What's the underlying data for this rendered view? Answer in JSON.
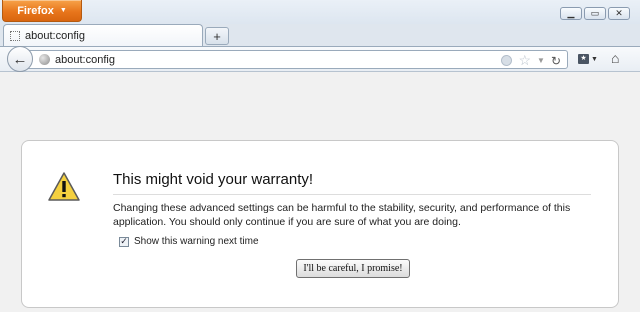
{
  "window": {
    "firefox_button_label": "Firefox",
    "controls": {
      "minimize": "▁",
      "restore": "▭",
      "close": "✕"
    }
  },
  "tabs": [
    {
      "label": "about:config",
      "active": true
    }
  ],
  "new_tab_symbol": "+",
  "navbar": {
    "url": "about:config"
  },
  "warning": {
    "title": "This might void your warranty!",
    "description": "Changing these advanced settings can be harmful to the stability, security, and performance of this application. You should only continue if you are sure of what you are doing.",
    "checkbox_label": "Show this warning next time",
    "checkbox_checked": true,
    "button_label": "I'll be careful, I promise!"
  },
  "colors": {
    "firefox_button": "#e8761c",
    "warning_icon_fill": "#f4d03f"
  },
  "icons": [
    "back-arrow-icon",
    "globe-icon",
    "star-icon",
    "reload-icon",
    "bookmarks-icon",
    "home-icon",
    "warning-icon"
  ]
}
